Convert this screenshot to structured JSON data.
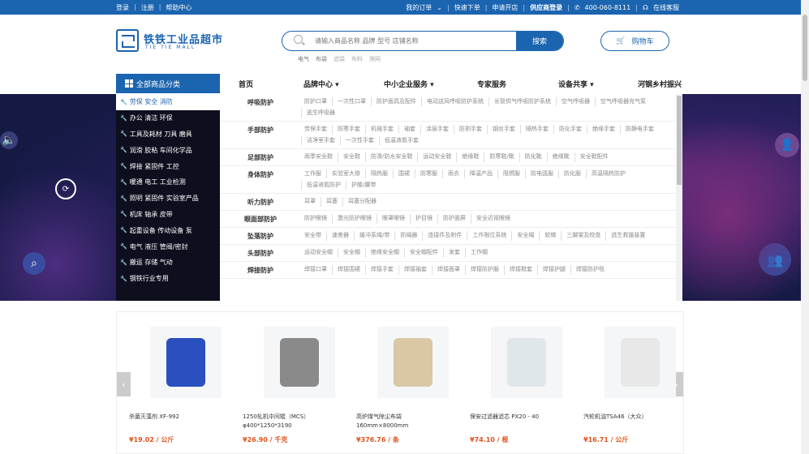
{
  "topbar": {
    "login": "登录",
    "register": "注册",
    "help": "帮助中心",
    "my_orders": "我的订单",
    "quick_order": "快速下单",
    "open_store": "申请开店",
    "supplier_login": "供应商登录",
    "phone": "400-060-8111",
    "online_service": "在线客服"
  },
  "logo": {
    "cn": "铁铁工业品超市",
    "en": "TIE TIE MALL"
  },
  "search": {
    "placeholder": "请输入商品名称 品牌 型号 店铺名称",
    "button": "搜索",
    "hotwords": [
      "电气",
      "布袋",
      "滤袋",
      "布料",
      "筛网"
    ]
  },
  "cart": {
    "label": "购物车"
  },
  "nav": {
    "all_categories": "全部商品分类",
    "items": [
      "首页",
      "品牌中心",
      "中小企业服务",
      "专家服务",
      "设备共享",
      "河钢乡村振兴"
    ]
  },
  "categories": [
    "劳保 安全 消防",
    "办公 清洁 环保",
    "工具及耗材 刀具 磨具",
    "润滑 胶粘 车间化学品",
    "焊接 紧固件 工控",
    "暖通 电工 工业检测",
    "照明 紧固件 实验室产品",
    "机床 轴承 皮带",
    "起重设备 传动设备 泵",
    "电气 液压 管阀/密封",
    "搬运 存储 气动",
    "钢铁行业专用"
  ],
  "panel": [
    {
      "label": "呼吸防护",
      "items": [
        "防护口罩",
        "一次性口罩",
        "防护面具及配件",
        "电动送风呼吸防护系统",
        "长管供气呼吸防护系统",
        "空气呼吸器",
        "空气呼吸器充气泵",
        "逃生呼吸器"
      ]
    },
    {
      "label": "手部防护",
      "items": [
        "劳保手套",
        "防寒手套",
        "机械手套",
        "袖套",
        "涂层手套",
        "防割手套",
        "钢丝手套",
        "隔热手套",
        "防化手套",
        "绝缘手套",
        "防静电手套",
        "洁净室手套",
        "一次性手套",
        "低温液氮手套"
      ]
    },
    {
      "label": "足部防护",
      "items": [
        "雨季安全鞋",
        "安全鞋",
        "防滑/防水安全鞋",
        "运动安全鞋",
        "绝缘鞋",
        "防寒鞋/靴",
        "防化靴",
        "绝缘靴",
        "安全鞋配件"
      ]
    },
    {
      "label": "身体防护",
      "items": [
        "工作服",
        "实验室大褂",
        "隔热服",
        "围裙",
        "防寒服",
        "雨衣",
        "降温产品",
        "阻燃服",
        "防电弧服",
        "防化服",
        "高温隔热防护",
        "低温液氮防护",
        "护膝/腰带"
      ]
    },
    {
      "label": "听力防护",
      "items": [
        "耳罩",
        "耳塞",
        "耳塞分配器"
      ]
    },
    {
      "label": "眼面部防护",
      "items": [
        "防护眼镜",
        "激光防护眼镜",
        "眼罩眼镜",
        "护目镜",
        "防护面屏",
        "安全近视眼镜"
      ]
    },
    {
      "label": "坠落防护",
      "items": [
        "安全带",
        "速差器",
        "缓冲系绳/带",
        "抓绳器",
        "连接件及附件",
        "工作限位系统",
        "安全绳",
        "软梯",
        "三脚架及绞盘",
        "逃生救援装置"
      ]
    },
    {
      "label": "头部防护",
      "items": [
        "运动安全帽",
        "安全帽",
        "绝缘安全帽",
        "安全帽配件",
        "发套",
        "工作帽"
      ]
    },
    {
      "label": "焊接防护",
      "items": [
        "焊接口罩",
        "焊接围裙",
        "焊接手套",
        "焊接袖套",
        "焊接面罩",
        "焊接防护服",
        "焊接鞋套",
        "焊接护腿",
        "焊接防护毯"
      ]
    }
  ],
  "products": [
    {
      "name": "杀菌灭藻剂 XF-992",
      "price": "¥19.02 / 公斤",
      "color": "#2a4fbf"
    },
    {
      "name": "1250轧机中间辊（MCS）φ400*1250*3190",
      "price": "¥26.90 / 千克",
      "color": "#8a8a8a"
    },
    {
      "name": "高炉煤气除尘布袋 160mm×8000mm",
      "price": "¥376.76 / 条",
      "color": "#d9c7a6"
    },
    {
      "name": "保安过滤器滤芯 PX20 - 40",
      "price": "¥74.10 / 根",
      "color": "#dfe7ea"
    },
    {
      "name": "汽轮机油TSA46（大众）",
      "price": "¥16.71 / 公斤",
      "color": "#e8e8e8"
    }
  ]
}
